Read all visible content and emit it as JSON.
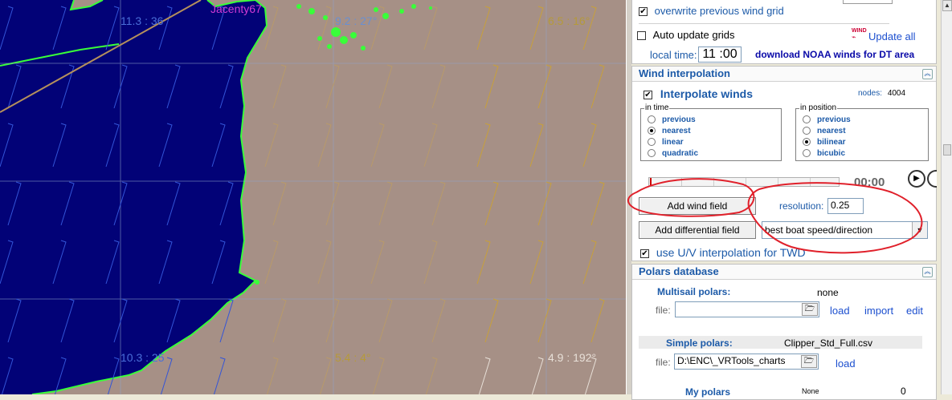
{
  "map": {
    "wind_labels": [
      {
        "text": "11.3 : 36"
      },
      {
        "text": "9.2 : 27°"
      },
      {
        "text": "6.5 : 16°"
      },
      {
        "text": "10.3 : 25"
      },
      {
        "text": "5.4 : 4°"
      },
      {
        "text": "4.9 : 192°"
      }
    ],
    "boat_name": "Jacenty67",
    "colors": {
      "sea": "#020277",
      "land": "#a69086",
      "coast": "#39ff39",
      "route": "#b5905c"
    }
  },
  "panel": {
    "top": {
      "overwrite_label": "overwrite previous wind grid",
      "overwrite_checked": "✔",
      "auto_update_label": "Auto update grids",
      "update_all_icon_text": "WIND",
      "update_all_label": "Update all",
      "local_time_label": "local time:",
      "local_time_value": "11 :00",
      "download_label": "download NOAA winds for DT area"
    },
    "wind_interp": {
      "title": "Wind interpolation",
      "interpolate_label": "Interpolate winds",
      "interpolate_checked": "✔",
      "nodes_label": "nodes:",
      "nodes_value": "4004",
      "in_time_label": "in time",
      "in_time_options": [
        "previous",
        "nearest",
        "linear",
        "quadratic"
      ],
      "in_time_selected": "nearest",
      "in_position_label": "in position",
      "in_position_options": [
        "previous",
        "nearest",
        "bilinear",
        "bicubic"
      ],
      "in_position_selected": "bilinear",
      "time_display": "00:00",
      "add_wind_field": "Add wind field",
      "resolution_label": "resolution:",
      "resolution_value": "0.25",
      "add_diff_field": "Add differential field",
      "field_select_value": "best boat speed/direction",
      "uv_label": "use U/V interpolation for TWD",
      "uv_checked": "✔"
    },
    "polars": {
      "title": "Polars database",
      "multisail_label": "Multisail polars:",
      "multisail_value": "none",
      "file_label": "file:",
      "multisail_file": "",
      "load": "load",
      "import": "import",
      "edit": "edit",
      "simple_label": "Simple polars:",
      "simple_value": "Clipper_Std_Full.csv",
      "simple_file": "D:\\ENC\\_VRTools_charts",
      "my_polars_label": "My polars",
      "my_polars_value": "None",
      "my_polars_count": "0"
    }
  }
}
